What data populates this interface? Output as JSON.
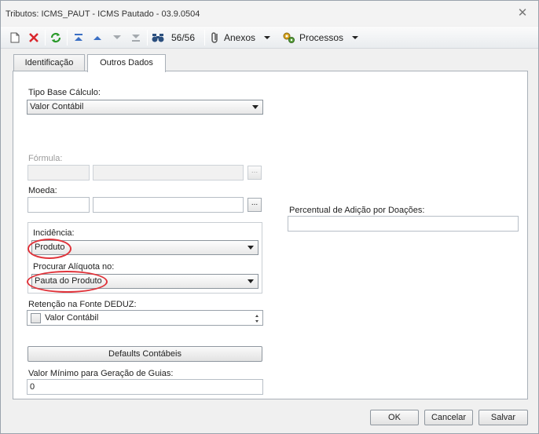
{
  "window": {
    "title": "Tributos: ICMS_PAUT - ICMS Pautado - 03.9.0504"
  },
  "toolbar": {
    "record_counter": "56/56",
    "anexos_label": "Anexos",
    "processos_label": "Processos"
  },
  "tabs": [
    {
      "label": "Identificação"
    },
    {
      "label": "Outros Dados"
    }
  ],
  "form": {
    "tipo_base_calculo": {
      "label": "Tipo Base Cálculo:",
      "value": "Valor Contábil"
    },
    "formula": {
      "label": "Fórmula:",
      "code": "",
      "description": ""
    },
    "moeda": {
      "label": "Moeda:",
      "code": "",
      "description": ""
    },
    "incidencia": {
      "label": "Incidência:",
      "value": "Produto"
    },
    "procurar_aliquota": {
      "label": "Procurar Alíquota no:",
      "value": "Pauta do Produto"
    },
    "retencao": {
      "label": "Retenção na Fonte DEDUZ:",
      "option_label": "Valor Contábil",
      "checked": false
    },
    "defaults_button": "Defaults Contábeis",
    "valor_minimo": {
      "label": "Valor Mínimo para Geração de Guias:",
      "value": "0"
    },
    "percentual_doacoes": {
      "label": "Percentual de Adição por Doações:",
      "value": ""
    }
  },
  "footer": {
    "ok": "OK",
    "cancelar": "Cancelar",
    "salvar": "Salvar"
  },
  "highlight_color": "#e0333a"
}
